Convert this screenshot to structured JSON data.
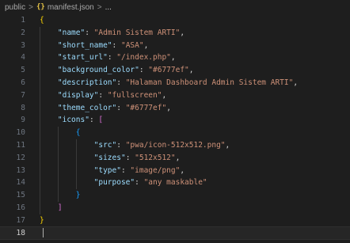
{
  "breadcrumb": {
    "folder": "public",
    "separator": ">",
    "file_icon": "{}",
    "file": "manifest.json",
    "symbol": "..."
  },
  "editor": {
    "current_line": "18",
    "lines": [
      {
        "n": "1",
        "t": [
          {
            "c": "b1",
            "v": "{"
          }
        ]
      },
      {
        "n": "2",
        "t": [
          {
            "c": "k",
            "v": "\"name\""
          },
          {
            "c": "p",
            "v": ": "
          },
          {
            "c": "s",
            "v": "\"Admin Sistem ARTI\""
          },
          {
            "c": "p",
            "v": ","
          }
        ]
      },
      {
        "n": "3",
        "t": [
          {
            "c": "k",
            "v": "\"short_name\""
          },
          {
            "c": "p",
            "v": ": "
          },
          {
            "c": "s",
            "v": "\"ASA\""
          },
          {
            "c": "p",
            "v": ","
          }
        ]
      },
      {
        "n": "4",
        "t": [
          {
            "c": "k",
            "v": "\"start_url\""
          },
          {
            "c": "p",
            "v": ": "
          },
          {
            "c": "s",
            "v": "\"/index.php\""
          },
          {
            "c": "p",
            "v": ","
          }
        ]
      },
      {
        "n": "5",
        "t": [
          {
            "c": "k",
            "v": "\"background_color\""
          },
          {
            "c": "p",
            "v": ": "
          },
          {
            "c": "s",
            "v": "\"#6777ef\""
          },
          {
            "c": "p",
            "v": ","
          }
        ]
      },
      {
        "n": "6",
        "t": [
          {
            "c": "k",
            "v": "\"description\""
          },
          {
            "c": "p",
            "v": ": "
          },
          {
            "c": "s",
            "v": "\"Halaman Dashboard Admin Sistem ARTI\""
          },
          {
            "c": "p",
            "v": ","
          }
        ]
      },
      {
        "n": "7",
        "t": [
          {
            "c": "k",
            "v": "\"display\""
          },
          {
            "c": "p",
            "v": ": "
          },
          {
            "c": "s",
            "v": "\"fullscreen\""
          },
          {
            "c": "p",
            "v": ","
          }
        ]
      },
      {
        "n": "8",
        "t": [
          {
            "c": "k",
            "v": "\"theme_color\""
          },
          {
            "c": "p",
            "v": ": "
          },
          {
            "c": "s",
            "v": "\"#6777ef\""
          },
          {
            "c": "p",
            "v": ","
          }
        ]
      },
      {
        "n": "9",
        "t": [
          {
            "c": "k",
            "v": "\"icons\""
          },
          {
            "c": "p",
            "v": ": "
          },
          {
            "c": "b2",
            "v": "["
          }
        ]
      },
      {
        "n": "10",
        "t": [
          {
            "c": "b3",
            "v": "{"
          }
        ]
      },
      {
        "n": "11",
        "t": [
          {
            "c": "k",
            "v": "\"src\""
          },
          {
            "c": "p",
            "v": ": "
          },
          {
            "c": "s",
            "v": "\"pwa/icon-512x512.png\""
          },
          {
            "c": "p",
            "v": ","
          }
        ]
      },
      {
        "n": "12",
        "t": [
          {
            "c": "k",
            "v": "\"sizes\""
          },
          {
            "c": "p",
            "v": ": "
          },
          {
            "c": "s",
            "v": "\"512x512\""
          },
          {
            "c": "p",
            "v": ","
          }
        ]
      },
      {
        "n": "13",
        "t": [
          {
            "c": "k",
            "v": "\"type\""
          },
          {
            "c": "p",
            "v": ": "
          },
          {
            "c": "s",
            "v": "\"image/png\""
          },
          {
            "c": "p",
            "v": ","
          }
        ]
      },
      {
        "n": "14",
        "t": [
          {
            "c": "k",
            "v": "\"purpose\""
          },
          {
            "c": "p",
            "v": ": "
          },
          {
            "c": "s",
            "v": "\"any maskable\""
          }
        ]
      },
      {
        "n": "15",
        "t": [
          {
            "c": "b3",
            "v": "}"
          }
        ]
      },
      {
        "n": "16",
        "t": [
          {
            "c": "b2",
            "v": "]"
          }
        ]
      },
      {
        "n": "17",
        "t": [
          {
            "c": "b1",
            "v": "}"
          }
        ]
      },
      {
        "n": "18",
        "t": []
      }
    ]
  }
}
